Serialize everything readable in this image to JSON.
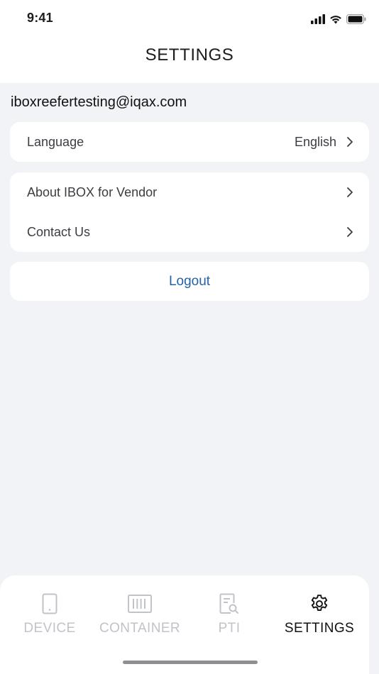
{
  "status_bar": {
    "time": "9:41",
    "icons": [
      "signal-icon",
      "wifi-icon",
      "battery-icon"
    ]
  },
  "header": {
    "title": "SETTINGS"
  },
  "account": {
    "email": "iboxreefertesting@iqax.com"
  },
  "settings": {
    "language": {
      "label": "Language",
      "value": "English"
    },
    "about": {
      "label": "About IBOX for Vendor"
    },
    "contact": {
      "label": "Contact Us"
    }
  },
  "logout": {
    "label": "Logout",
    "color": "#2563a6"
  },
  "tabs": [
    {
      "label": "DEVICE",
      "icon": "phone-icon",
      "active": false
    },
    {
      "label": "CONTAINER",
      "icon": "container-icon",
      "active": false
    },
    {
      "label": "PTI",
      "icon": "report-search-icon",
      "active": false
    },
    {
      "label": "SETTINGS",
      "icon": "gear-icon",
      "active": true
    }
  ],
  "colors": {
    "background": "#f2f3f7",
    "card": "#ffffff",
    "inactive_tab": "#c0c3c9",
    "active_tab": "#111111"
  }
}
